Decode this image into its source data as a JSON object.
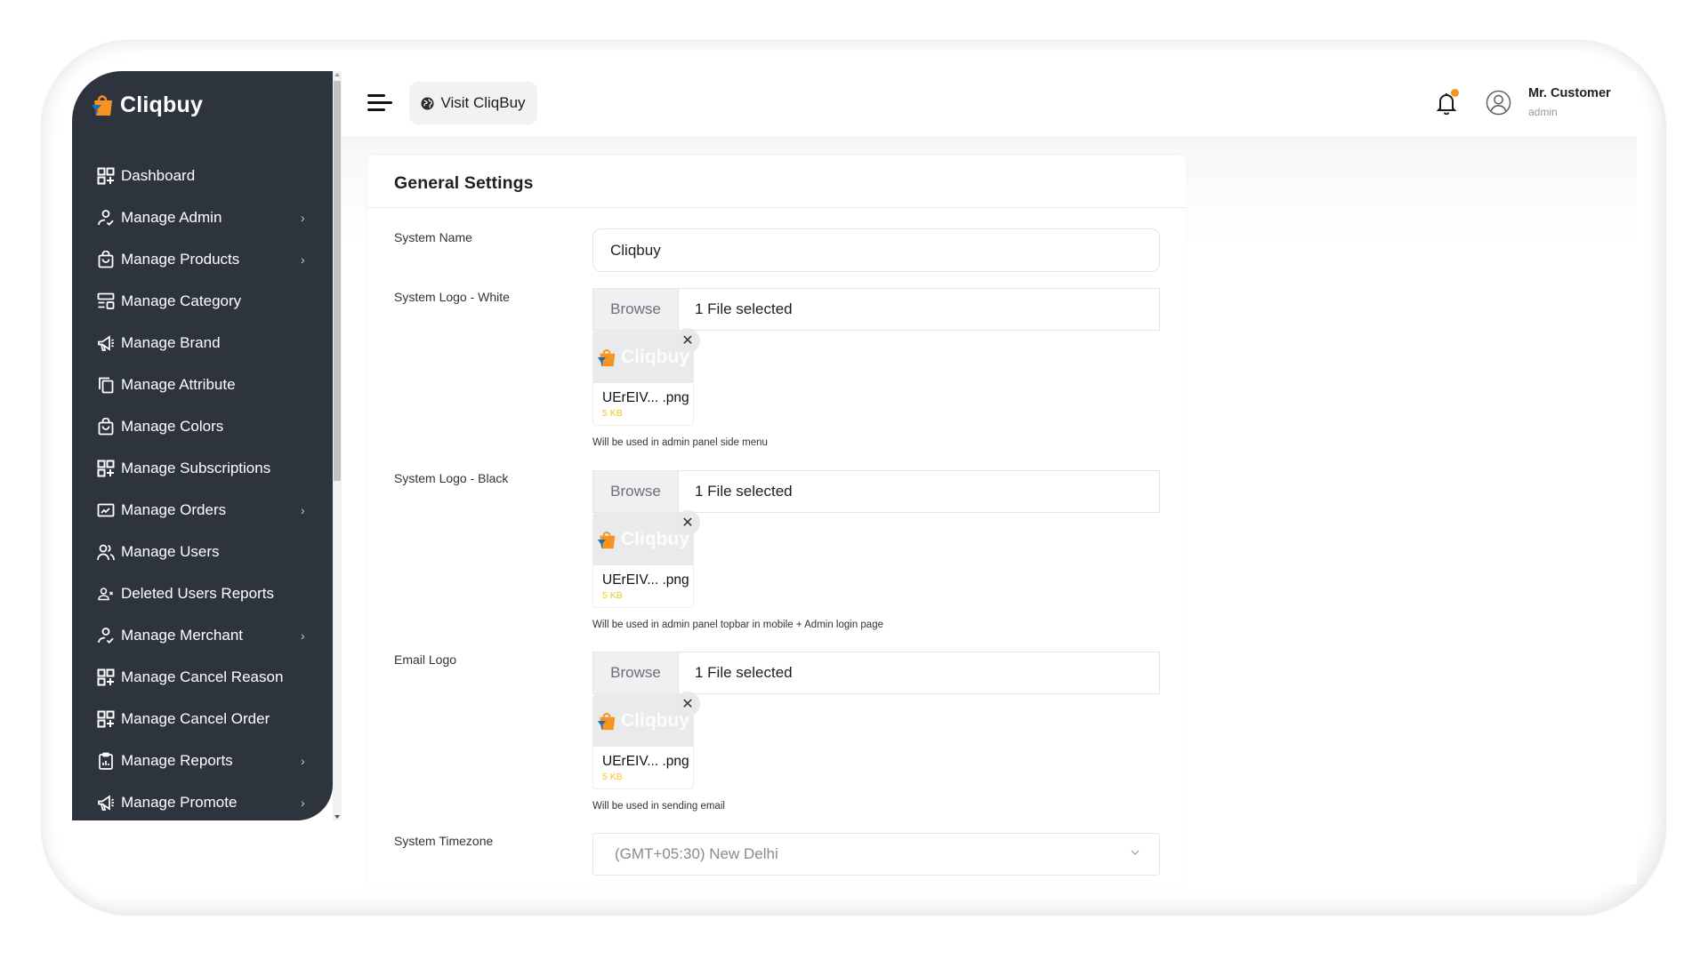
{
  "brand": {
    "name": "Cliqbuy",
    "colors": {
      "orange": "#f7931e",
      "blue": "#1f6fb6",
      "sidebar_bg": "#2e343d"
    }
  },
  "sidebar": {
    "items": [
      {
        "label": "Dashboard",
        "icon": "grid-plus-icon",
        "has_submenu": false
      },
      {
        "label": "Manage Admin",
        "icon": "user-check-icon",
        "has_submenu": true
      },
      {
        "label": "Manage Products",
        "icon": "shopping-bag-icon",
        "has_submenu": true
      },
      {
        "label": "Manage Category",
        "icon": "layout-icon",
        "has_submenu": false
      },
      {
        "label": "Manage Brand",
        "icon": "megaphone-icon",
        "has_submenu": false
      },
      {
        "label": "Manage Attribute",
        "icon": "copy-icon",
        "has_submenu": false
      },
      {
        "label": "Manage Colors",
        "icon": "shopping-bag-icon",
        "has_submenu": false
      },
      {
        "label": "Manage Subscriptions",
        "icon": "grid-plus-icon",
        "has_submenu": false
      },
      {
        "label": "Manage Orders",
        "icon": "chart-monitor-icon",
        "has_submenu": true
      },
      {
        "label": "Manage Users",
        "icon": "users-icon",
        "has_submenu": false
      },
      {
        "label": "Deleted Users Reports",
        "icon": "user-x-icon",
        "has_submenu": false
      },
      {
        "label": "Manage Merchant",
        "icon": "user-check-icon",
        "has_submenu": true
      },
      {
        "label": "Manage Cancel Reason",
        "icon": "grid-plus-icon",
        "has_submenu": false
      },
      {
        "label": "Manage Cancel Order",
        "icon": "grid-plus-icon",
        "has_submenu": false
      },
      {
        "label": "Manage Reports",
        "icon": "clipboard-chart-icon",
        "has_submenu": true
      },
      {
        "label": "Manage Promote",
        "icon": "megaphone-icon",
        "has_submenu": true
      }
    ],
    "chevron": "›"
  },
  "topbar": {
    "visit_label": "Visit CliqBuy",
    "notification_dot_color": "#f7931e",
    "user_name": "Mr. Customer",
    "user_role": "admin"
  },
  "settings": {
    "title": "General Settings",
    "system_name": {
      "label": "System Name",
      "value": "Cliqbuy"
    },
    "logo_white": {
      "label": "System Logo - White",
      "browse_label": "Browse",
      "status": "1 File selected",
      "file_name": "UErEIV... .png",
      "file_size": "5 KB",
      "preview_text": "Cliqbuy",
      "help": "Will be used in admin panel side menu"
    },
    "logo_black": {
      "label": "System Logo - Black",
      "browse_label": "Browse",
      "status": "1 File selected",
      "file_name": "UErEIV... .png",
      "file_size": "5 KB",
      "preview_text": "Cliqbuy",
      "help": "Will be used in admin panel topbar in mobile + Admin login page"
    },
    "email_logo": {
      "label": "Email Logo",
      "browse_label": "Browse",
      "status": "1 File selected",
      "file_name": "UErEIV... .png",
      "file_size": "5 KB",
      "preview_text": "Cliqbuy",
      "help": "Will be used in sending email"
    },
    "timezone": {
      "label": "System Timezone",
      "value": "(GMT+05:30) New Delhi"
    },
    "close_glyph": "✕"
  }
}
